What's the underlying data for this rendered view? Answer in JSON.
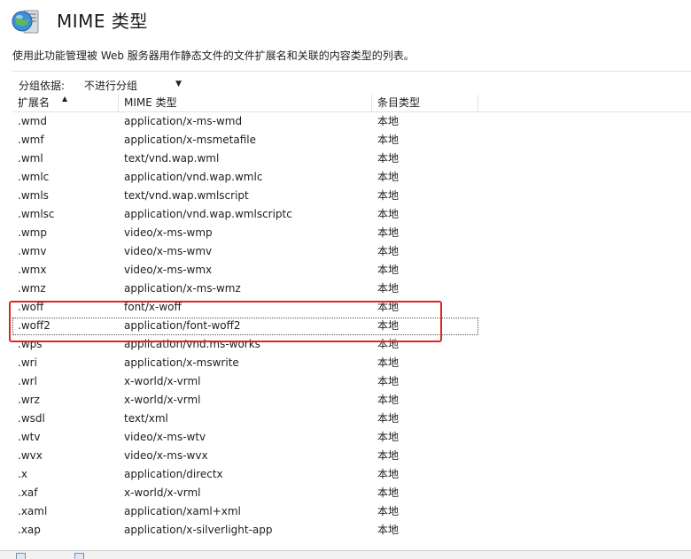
{
  "header": {
    "title": "MIME 类型"
  },
  "description": "使用此功能管理被 Web 服务器用作静态文件的文件扩展名和关联的内容类型的列表。",
  "groupbar": {
    "label": "分组依据:",
    "value": "不进行分组"
  },
  "columns": [
    "扩展名",
    "MIME 类型",
    "条目类型"
  ],
  "rows": [
    {
      "ext": ".wmd",
      "mime": "application/x-ms-wmd",
      "type": "本地"
    },
    {
      "ext": ".wmf",
      "mime": "application/x-msmetafile",
      "type": "本地"
    },
    {
      "ext": ".wml",
      "mime": "text/vnd.wap.wml",
      "type": "本地"
    },
    {
      "ext": ".wmlc",
      "mime": "application/vnd.wap.wmlc",
      "type": "本地"
    },
    {
      "ext": ".wmls",
      "mime": "text/vnd.wap.wmlscript",
      "type": "本地"
    },
    {
      "ext": ".wmlsc",
      "mime": "application/vnd.wap.wmlscriptc",
      "type": "本地"
    },
    {
      "ext": ".wmp",
      "mime": "video/x-ms-wmp",
      "type": "本地"
    },
    {
      "ext": ".wmv",
      "mime": "video/x-ms-wmv",
      "type": "本地"
    },
    {
      "ext": ".wmx",
      "mime": "video/x-ms-wmx",
      "type": "本地"
    },
    {
      "ext": ".wmz",
      "mime": "application/x-ms-wmz",
      "type": "本地"
    },
    {
      "ext": ".woff",
      "mime": "font/x-woff",
      "type": "本地"
    },
    {
      "ext": ".woff2",
      "mime": "application/font-woff2",
      "type": "本地"
    },
    {
      "ext": ".wps",
      "mime": "application/vnd.ms-works",
      "type": "本地"
    },
    {
      "ext": ".wri",
      "mime": "application/x-mswrite",
      "type": "本地"
    },
    {
      "ext": ".wrl",
      "mime": "x-world/x-vrml",
      "type": "本地"
    },
    {
      "ext": ".wrz",
      "mime": "x-world/x-vrml",
      "type": "本地"
    },
    {
      "ext": ".wsdl",
      "mime": "text/xml",
      "type": "本地"
    },
    {
      "ext": ".wtv",
      "mime": "video/x-ms-wtv",
      "type": "本地"
    },
    {
      "ext": ".wvx",
      "mime": "video/x-ms-wvx",
      "type": "本地"
    },
    {
      "ext": ".x",
      "mime": "application/directx",
      "type": "本地"
    },
    {
      "ext": ".xaf",
      "mime": "x-world/x-vrml",
      "type": "本地"
    },
    {
      "ext": ".xaml",
      "mime": "application/xaml+xml",
      "type": "本地"
    },
    {
      "ext": ".xap",
      "mime": "application/x-silverlight-app",
      "type": "本地"
    }
  ],
  "selected_row": 11,
  "colors": {
    "highlight": "#e02424"
  }
}
